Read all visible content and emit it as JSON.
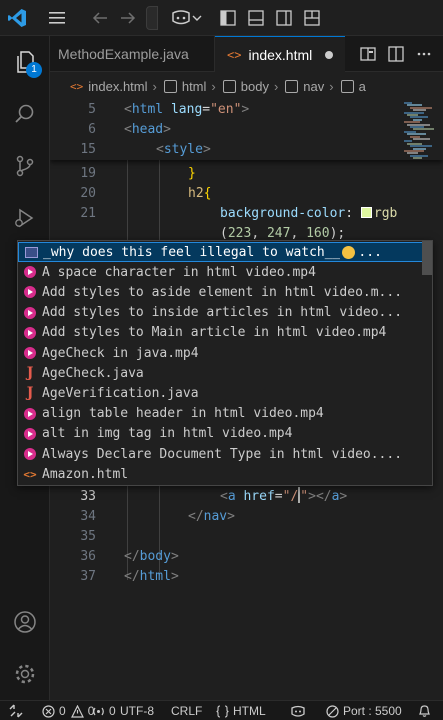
{
  "titlebar": {
    "logo_icon": "vscode-logo-icon",
    "menu_icon": "hamburger-menu-icon",
    "back_icon": "arrow-left-icon",
    "forward_icon": "arrow-right-icon",
    "copilot_icon": "copilot-icon",
    "copilot_chevron": "chevron-down-icon"
  },
  "tabs": [
    {
      "label": "MethodExample.java",
      "active": false
    },
    {
      "label": "index.html",
      "prefix": "<>",
      "active": true,
      "modified": true
    }
  ],
  "breadcrumb": {
    "file": "index.html",
    "file_prefix": "<>",
    "items": [
      "html",
      "body",
      "nav",
      "a"
    ]
  },
  "editor": {
    "sticky_lines": [
      {
        "num": "5",
        "indent": 0,
        "parts": [
          [
            "<",
            "pun"
          ],
          [
            "html",
            "tag"
          ],
          [
            " ",
            "txt"
          ],
          [
            "lang",
            "attr"
          ],
          [
            "=",
            "txt"
          ],
          [
            "\"en\"",
            "str"
          ],
          [
            ">",
            "pun"
          ]
        ]
      },
      {
        "num": "6",
        "indent": 0,
        "parts": [
          [
            "<",
            "pun"
          ],
          [
            "head",
            "tag"
          ],
          [
            ">",
            "pun"
          ]
        ]
      },
      {
        "num": "15",
        "indent": 1,
        "parts": [
          [
            "<",
            "pun"
          ],
          [
            "style",
            "tag"
          ],
          [
            ">",
            "pun"
          ]
        ]
      }
    ],
    "lines": [
      {
        "num": "19",
        "indent": 2,
        "parts": [
          [
            "}",
            "brk"
          ]
        ]
      },
      {
        "num": "20",
        "indent": 2,
        "parts": [
          [
            "h2",
            "sel"
          ],
          [
            "{",
            "brk"
          ]
        ]
      },
      {
        "num": "21",
        "indent": 3,
        "parts": [
          [
            "background-color",
            "prop"
          ],
          [
            ": ",
            "txt"
          ],
          [
            "SWATCH",
            "swatch"
          ],
          [
            "rgb",
            "fn"
          ]
        ]
      },
      {
        "num": "",
        "indent": 3,
        "parts": [
          [
            "(",
            "txt"
          ],
          [
            "223",
            "num"
          ],
          [
            ", ",
            "txt"
          ],
          [
            "247",
            "num"
          ],
          [
            ", ",
            "txt"
          ],
          [
            "160",
            "num"
          ],
          [
            ");",
            "txt"
          ]
        ]
      },
      {
        "num": "33",
        "indent": 3,
        "active": true,
        "parts": [
          [
            "<",
            "pun"
          ],
          [
            "a",
            "tag"
          ],
          [
            " ",
            "txt"
          ],
          [
            "href",
            "attr"
          ],
          [
            "=",
            "txt"
          ],
          [
            "\"/",
            "str"
          ],
          [
            "CURSOR",
            "cursor"
          ],
          [
            "\"",
            "str"
          ],
          [
            ">",
            "pun"
          ],
          [
            "</",
            "pun"
          ],
          [
            "a",
            "tag"
          ],
          [
            ">",
            "pun"
          ]
        ]
      },
      {
        "num": "34",
        "indent": 2,
        "parts": [
          [
            "</",
            "pun"
          ],
          [
            "nav",
            "tag"
          ],
          [
            ">",
            "pun"
          ]
        ]
      },
      {
        "num": "35",
        "indent": 0,
        "parts": []
      },
      {
        "num": "36",
        "indent": 0,
        "parts": [
          [
            "</",
            "pun"
          ],
          [
            "body",
            "tag"
          ],
          [
            ">",
            "pun"
          ]
        ]
      },
      {
        "num": "37",
        "indent": 0,
        "parts": [
          [
            "</",
            "pun"
          ],
          [
            "html",
            "tag"
          ],
          [
            ">",
            "pun"
          ]
        ]
      }
    ]
  },
  "suggestions": [
    {
      "label": "_why does this feel illegal to watch__",
      "emoji": "flushed-face",
      "suffix": "...",
      "kind": "image",
      "selected": true
    },
    {
      "label": "A space character in html video.mp4",
      "kind": "video"
    },
    {
      "label": "Add styles to aside element in html video.m...",
      "kind": "video"
    },
    {
      "label": "Add styles to inside articles in html video...",
      "kind": "video"
    },
    {
      "label": "Add styles to Main article in html video.mp4",
      "kind": "video"
    },
    {
      "label": "AgeCheck in java.mp4",
      "kind": "video"
    },
    {
      "label": "AgeCheck.java",
      "kind": "java"
    },
    {
      "label": "AgeVerification.java",
      "kind": "java"
    },
    {
      "label": "align table header in html video.mp4",
      "kind": "video"
    },
    {
      "label": "alt in img tag in html video.mp4",
      "kind": "video"
    },
    {
      "label": "Always Declare Document Type in html video....",
      "kind": "video"
    },
    {
      "label": "Amazon.html",
      "kind": "html"
    }
  ],
  "activitybar": {
    "explorer_badge": "1"
  },
  "statusbar": {
    "remote_icon": "remote-icon",
    "errors": "0",
    "warnings": "0",
    "ports_icon": "broadcast-icon",
    "ports": "0",
    "encoding": "UTF-8",
    "eol": "CRLF",
    "language": "HTML",
    "port_label": "Port : 5500"
  }
}
